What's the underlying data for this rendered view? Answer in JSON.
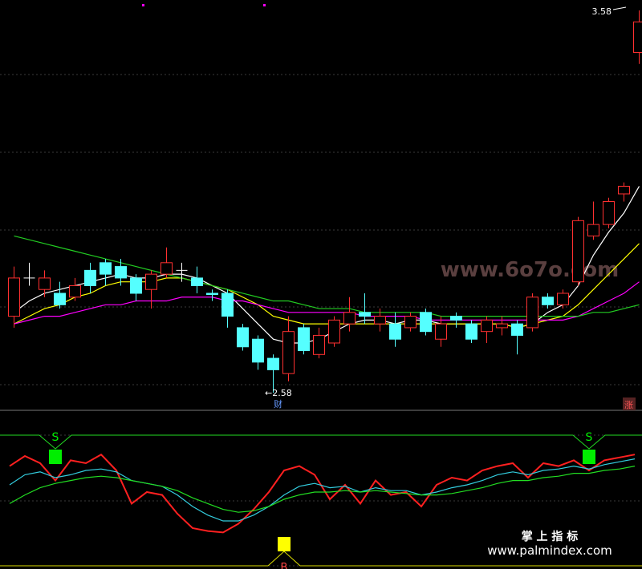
{
  "chart_data": [
    {
      "type": "candlestick",
      "title": "",
      "price_range": [
        2.58,
        3.58
      ],
      "annotations": {
        "high_label": "3.58",
        "low_label": "←2.58",
        "event_label_mid": "财",
        "event_label_right": "涨"
      },
      "candles": [
        {
          "o": 2.78,
          "c": 2.88,
          "h": 2.91,
          "l": 2.75,
          "color": "red"
        },
        {
          "o": 2.88,
          "c": 2.88,
          "h": 2.92,
          "l": 2.86,
          "color": "white"
        },
        {
          "o": 2.88,
          "c": 2.85,
          "h": 2.9,
          "l": 2.83,
          "color": "red"
        },
        {
          "o": 2.81,
          "c": 2.84,
          "h": 2.87,
          "l": 2.8,
          "color": "cyan"
        },
        {
          "o": 2.83,
          "c": 2.86,
          "h": 2.88,
          "l": 2.82,
          "color": "red"
        },
        {
          "o": 2.86,
          "c": 2.9,
          "h": 2.92,
          "l": 2.84,
          "color": "cyan"
        },
        {
          "o": 2.89,
          "c": 2.92,
          "h": 2.93,
          "l": 2.86,
          "color": "cyan"
        },
        {
          "o": 2.88,
          "c": 2.91,
          "h": 2.93,
          "l": 2.86,
          "color": "cyan"
        },
        {
          "o": 2.88,
          "c": 2.84,
          "h": 2.89,
          "l": 2.82,
          "color": "cyan"
        },
        {
          "o": 2.85,
          "c": 2.89,
          "h": 2.9,
          "l": 2.8,
          "color": "red"
        },
        {
          "o": 2.89,
          "c": 2.92,
          "h": 2.96,
          "l": 2.88,
          "color": "red"
        },
        {
          "o": 2.9,
          "c": 2.9,
          "h": 2.92,
          "l": 2.87,
          "color": "white"
        },
        {
          "o": 2.88,
          "c": 2.86,
          "h": 2.91,
          "l": 2.84,
          "color": "cyan"
        },
        {
          "o": 2.84,
          "c": 2.84,
          "h": 2.85,
          "l": 2.82,
          "color": "cyan"
        },
        {
          "o": 2.78,
          "c": 2.84,
          "h": 2.85,
          "l": 2.75,
          "color": "cyan"
        },
        {
          "o": 2.7,
          "c": 2.75,
          "h": 2.76,
          "l": 2.69,
          "color": "cyan"
        },
        {
          "o": 2.66,
          "c": 2.72,
          "h": 2.73,
          "l": 2.64,
          "color": "cyan"
        },
        {
          "o": 2.64,
          "c": 2.67,
          "h": 2.68,
          "l": 2.58,
          "color": "cyan"
        },
        {
          "o": 2.63,
          "c": 2.74,
          "h": 2.78,
          "l": 2.61,
          "color": "red"
        },
        {
          "o": 2.69,
          "c": 2.75,
          "h": 2.76,
          "l": 2.68,
          "color": "cyan"
        },
        {
          "o": 2.68,
          "c": 2.73,
          "h": 2.75,
          "l": 2.67,
          "color": "red"
        },
        {
          "o": 2.71,
          "c": 2.77,
          "h": 2.78,
          "l": 2.7,
          "color": "red"
        },
        {
          "o": 2.76,
          "c": 2.79,
          "h": 2.83,
          "l": 2.74,
          "color": "red"
        },
        {
          "o": 2.78,
          "c": 2.79,
          "h": 2.84,
          "l": 2.76,
          "color": "cyan"
        },
        {
          "o": 2.76,
          "c": 2.78,
          "h": 2.8,
          "l": 2.74,
          "color": "red"
        },
        {
          "o": 2.72,
          "c": 2.76,
          "h": 2.79,
          "l": 2.7,
          "color": "cyan"
        },
        {
          "o": 2.75,
          "c": 2.78,
          "h": 2.79,
          "l": 2.74,
          "color": "red"
        },
        {
          "o": 2.74,
          "c": 2.79,
          "h": 2.8,
          "l": 2.73,
          "color": "cyan"
        },
        {
          "o": 2.72,
          "c": 2.76,
          "h": 2.78,
          "l": 2.7,
          "color": "red"
        },
        {
          "o": 2.77,
          "c": 2.78,
          "h": 2.79,
          "l": 2.75,
          "color": "cyan"
        },
        {
          "o": 2.72,
          "c": 2.76,
          "h": 2.77,
          "l": 2.71,
          "color": "cyan"
        },
        {
          "o": 2.74,
          "c": 2.77,
          "h": 2.78,
          "l": 2.71,
          "color": "red"
        },
        {
          "o": 2.75,
          "c": 2.76,
          "h": 2.78,
          "l": 2.73,
          "color": "red"
        },
        {
          "o": 2.73,
          "c": 2.76,
          "h": 2.77,
          "l": 2.68,
          "color": "cyan"
        },
        {
          "o": 2.75,
          "c": 2.83,
          "h": 2.84,
          "l": 2.74,
          "color": "red"
        },
        {
          "o": 2.81,
          "c": 2.83,
          "h": 2.84,
          "l": 2.8,
          "color": "cyan"
        },
        {
          "o": 2.81,
          "c": 2.84,
          "h": 2.85,
          "l": 2.8,
          "color": "red"
        },
        {
          "o": 2.87,
          "c": 3.03,
          "h": 3.04,
          "l": 2.86,
          "color": "red"
        },
        {
          "o": 2.99,
          "c": 3.02,
          "h": 3.08,
          "l": 2.98,
          "color": "red"
        },
        {
          "o": 3.02,
          "c": 3.08,
          "h": 3.09,
          "l": 3.01,
          "color": "red"
        },
        {
          "o": 3.1,
          "c": 3.12,
          "h": 3.13,
          "l": 3.08,
          "color": "red"
        },
        {
          "o": 3.47,
          "c": 3.55,
          "h": 3.58,
          "l": 3.44,
          "color": "red"
        }
      ],
      "moving_averages": [
        {
          "color": "#ffffff",
          "values": [
            2.79,
            2.82,
            2.84,
            2.85,
            2.86,
            2.87,
            2.88,
            2.89,
            2.88,
            2.88,
            2.89,
            2.89,
            2.88,
            2.86,
            2.84,
            2.8,
            2.76,
            2.72,
            2.71,
            2.71,
            2.72,
            2.74,
            2.76,
            2.77,
            2.77,
            2.76,
            2.77,
            2.77,
            2.76,
            2.76,
            2.76,
            2.76,
            2.76,
            2.75,
            2.76,
            2.79,
            2.81,
            2.86,
            2.94,
            3.0,
            3.05,
            3.12
          ]
        },
        {
          "color": "#ffff00",
          "values": [
            2.76,
            2.78,
            2.8,
            2.81,
            2.83,
            2.84,
            2.86,
            2.87,
            2.87,
            2.87,
            2.88,
            2.88,
            2.87,
            2.86,
            2.85,
            2.83,
            2.81,
            2.78,
            2.77,
            2.76,
            2.76,
            2.76,
            2.76,
            2.76,
            2.76,
            2.76,
            2.76,
            2.76,
            2.76,
            2.76,
            2.76,
            2.76,
            2.76,
            2.75,
            2.76,
            2.77,
            2.78,
            2.81,
            2.85,
            2.89,
            2.93,
            2.97
          ]
        },
        {
          "color": "#ff00ff",
          "values": [
            2.76,
            2.77,
            2.78,
            2.78,
            2.79,
            2.8,
            2.81,
            2.81,
            2.82,
            2.82,
            2.82,
            2.83,
            2.83,
            2.83,
            2.82,
            2.82,
            2.81,
            2.8,
            2.79,
            2.79,
            2.79,
            2.79,
            2.79,
            2.78,
            2.78,
            2.78,
            2.78,
            2.77,
            2.77,
            2.77,
            2.77,
            2.77,
            2.77,
            2.77,
            2.77,
            2.77,
            2.77,
            2.78,
            2.8,
            2.82,
            2.84,
            2.87
          ]
        },
        {
          "color": "#22cc22",
          "values": [
            2.99,
            2.98,
            2.97,
            2.96,
            2.95,
            2.94,
            2.93,
            2.92,
            2.91,
            2.9,
            2.89,
            2.88,
            2.87,
            2.86,
            2.85,
            2.84,
            2.83,
            2.82,
            2.82,
            2.81,
            2.8,
            2.8,
            2.8,
            2.79,
            2.79,
            2.79,
            2.79,
            2.79,
            2.78,
            2.78,
            2.78,
            2.78,
            2.78,
            2.78,
            2.78,
            2.78,
            2.78,
            2.78,
            2.79,
            2.79,
            2.8,
            2.81
          ]
        }
      ]
    },
    {
      "type": "line",
      "title": "",
      "series": [
        {
          "color": "#ff2020",
          "values": [
            48,
            55,
            50,
            38,
            52,
            50,
            56,
            45,
            22,
            30,
            28,
            15,
            5,
            3,
            2,
            8,
            18,
            30,
            45,
            48,
            42,
            25,
            35,
            22,
            38,
            28,
            30,
            20,
            35,
            40,
            38,
            45,
            48,
            50,
            40,
            50,
            48,
            52,
            45,
            52,
            54,
            56
          ]
        },
        {
          "color": "#33ccdd",
          "values": [
            35,
            42,
            44,
            40,
            42,
            45,
            46,
            44,
            38,
            36,
            34,
            28,
            20,
            14,
            10,
            10,
            14,
            20,
            28,
            34,
            36,
            33,
            34,
            30,
            33,
            31,
            31,
            28,
            30,
            33,
            35,
            38,
            42,
            44,
            42,
            45,
            46,
            48,
            46,
            49,
            51,
            53
          ]
        },
        {
          "color": "#22dd22",
          "values": [
            22,
            28,
            33,
            36,
            38,
            40,
            41,
            40,
            38,
            36,
            34,
            31,
            26,
            22,
            18,
            16,
            17,
            20,
            25,
            28,
            30,
            30,
            31,
            30,
            31,
            30,
            29,
            28,
            28,
            29,
            31,
            33,
            36,
            38,
            38,
            40,
            41,
            43,
            43,
            45,
            46,
            48
          ]
        }
      ],
      "markers": [
        {
          "label": "S",
          "color": "#00ee00",
          "x": 3
        },
        {
          "label": "S",
          "color": "#00ee00",
          "x": 38
        },
        {
          "label": "B",
          "color": "#ffff00",
          "x": 18
        }
      ]
    }
  ],
  "watermarks": {
    "main": "www.6o7o.com",
    "title_cn": "掌 上 指 标",
    "site": "www.palmindex.com"
  },
  "colors": {
    "up": "#ff3030",
    "down": "#55ffff",
    "grid": "#3a3a3a",
    "separator": "#777777"
  }
}
